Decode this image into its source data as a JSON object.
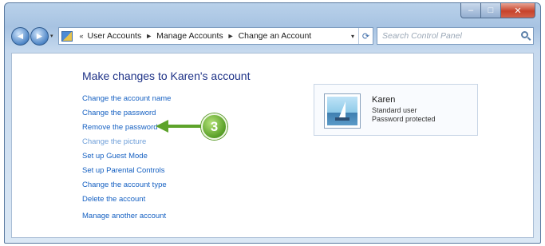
{
  "window": {
    "caption": {
      "minimize": "–",
      "maximize": "□",
      "close": "✕"
    }
  },
  "navigation": {
    "back_icon": "back-arrow-icon",
    "forward_icon": "forward-arrow-icon",
    "back_glyph": "◄",
    "forward_glyph": "►",
    "history_glyph": "▾",
    "breadcrumb_prefix": "«",
    "breadcrumb": [
      "User Accounts",
      "Manage Accounts",
      "Change an Account"
    ],
    "breadcrumb_separator": "►",
    "address_dropdown": "▾",
    "refresh_glyph": "⟳",
    "search_placeholder": "Search Control Panel"
  },
  "main": {
    "heading": "Make changes to Karen's account",
    "links": [
      {
        "label": "Change the account name"
      },
      {
        "label": "Change the password"
      },
      {
        "label": "Remove the password"
      },
      {
        "label": "Change the picture"
      },
      {
        "label": "Set up Guest Mode"
      },
      {
        "label": "Set up Parental Controls"
      },
      {
        "label": "Change the account type"
      },
      {
        "label": "Delete the account"
      },
      {
        "label": "Manage another account"
      }
    ],
    "callout": {
      "step": "3"
    }
  },
  "account": {
    "name": "Karen",
    "type": "Standard user",
    "password_status": "Password protected",
    "picture": "sailboat-picture"
  },
  "colors": {
    "link": "#1560c2",
    "link_visited": "#6f9fd9",
    "heading": "#1e3287",
    "callout": "#5da32b"
  }
}
